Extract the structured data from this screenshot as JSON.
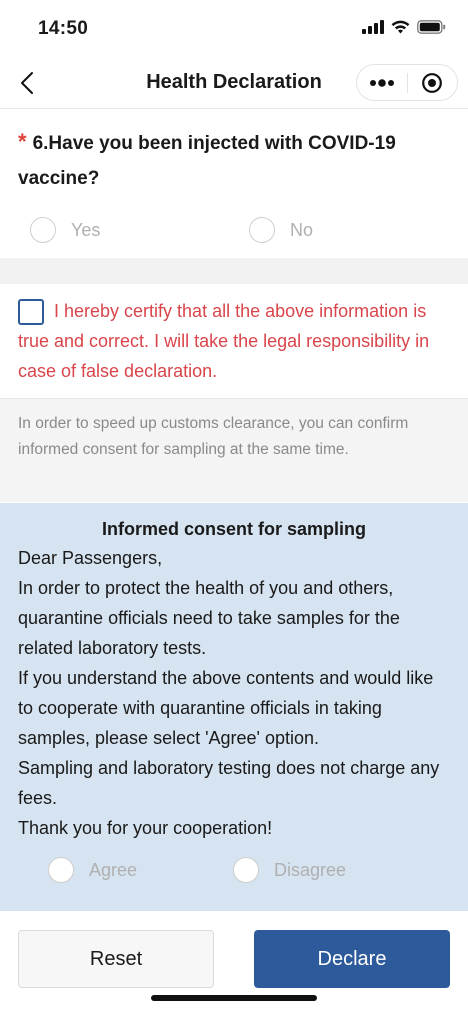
{
  "status_bar": {
    "time": "14:50",
    "icons": [
      "signal-icon",
      "wifi-icon",
      "battery-icon"
    ]
  },
  "nav": {
    "title": "Health Declaration",
    "icons": [
      "back-icon",
      "more-icon",
      "target-icon"
    ]
  },
  "question": {
    "required_mark": "*",
    "text": "6.Have you been injected with COVID-19 vaccine?",
    "options": [
      "Yes",
      "No"
    ]
  },
  "certify": {
    "text": "I hereby certify that all the above information is true and correct. I will take the legal responsibility in case of false declaration."
  },
  "consent_note": "In order to speed up customs clearance, you can confirm informed consent for sampling at the same time.",
  "consent": {
    "title": "Informed consent for sampling",
    "paragraphs": [
      "Dear Passengers,",
      "In order to protect the health of you and others, quarantine officials need to take samples for the related laboratory tests.",
      "If you understand the above contents and would like to cooperate with quarantine officials in taking samples, please select 'Agree' option.",
      "Sampling and laboratory testing does not charge any fees.",
      "Thank you for your cooperation!"
    ],
    "options": [
      "Agree",
      "Disagree"
    ]
  },
  "footer": {
    "reset_label": "Reset",
    "declare_label": "Declare"
  },
  "colors": {
    "accent": "#2d5a9a",
    "warning_text": "#d9454a",
    "consent_bg": "#d6e3f0"
  }
}
